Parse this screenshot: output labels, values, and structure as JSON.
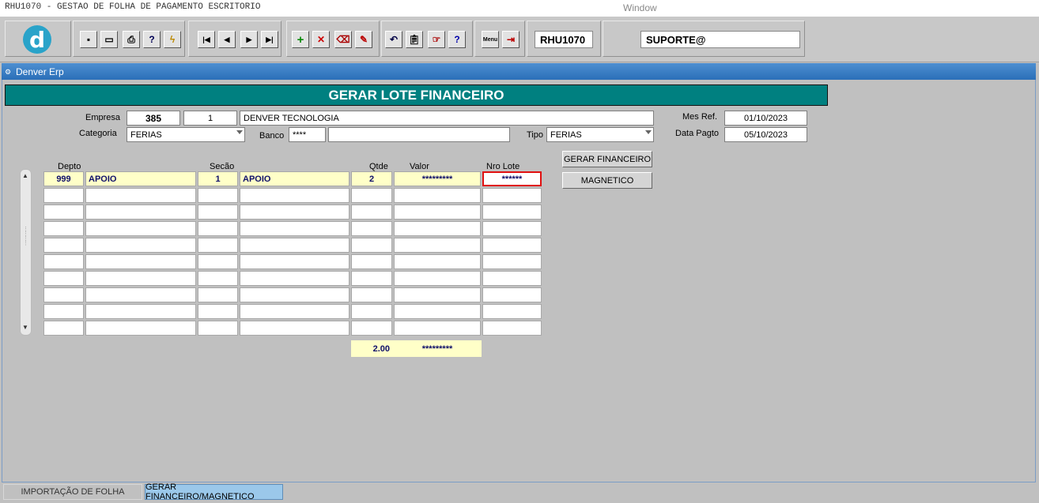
{
  "window": {
    "title": "RHU1070 - GESTAO DE FOLHA DE PAGAMENTO ESCRITORIO",
    "menu": "Window"
  },
  "toolbar": {
    "logo": "d",
    "program_code": "RHU1070",
    "user": "SUPORTE@",
    "menu_label": "Menu",
    "help_label": "?"
  },
  "mdi": {
    "title": "Denver Erp"
  },
  "form": {
    "header": "GERAR LOTE FINANCEIRO",
    "empresa_label": "Empresa",
    "empresa_code": "385",
    "empresa_sub": "1",
    "empresa_name": "DENVER TECNOLOGIA",
    "categoria_label": "Categoria",
    "categoria_value": "FERIAS",
    "banco_label": "Banco",
    "banco_code": "****",
    "banco_name": "",
    "tipo_label": "Tipo",
    "tipo_value": "FERIAS",
    "mes_ref_label": "Mes Ref.",
    "mes_ref_value": "01/10/2023",
    "data_pagto_label": "Data Pagto",
    "data_pagto_value": "05/10/2023",
    "gerar_button": "GERAR FINANCEIRO",
    "magnetico_button": "MAGNETICO"
  },
  "grid": {
    "headers": {
      "depto": "Depto",
      "secao": "Secão",
      "qtde": "Qtde",
      "valor": "Valor",
      "nro_lote": "Nro Lote"
    },
    "rows": [
      {
        "depto": "999",
        "depto_name": "APOIO",
        "secao": "1",
        "secao_name": "APOIO",
        "qtde": "2",
        "valor": "*********",
        "nro_lote": "******"
      }
    ],
    "total_qtde": "2.00",
    "total_valor": "*********"
  },
  "tabs": [
    {
      "label": "IMPORTAÇÃO DE FOLHA",
      "active": false
    },
    {
      "label": "GERAR FINANCEIRO/MAGNETICO",
      "active": true
    }
  ]
}
